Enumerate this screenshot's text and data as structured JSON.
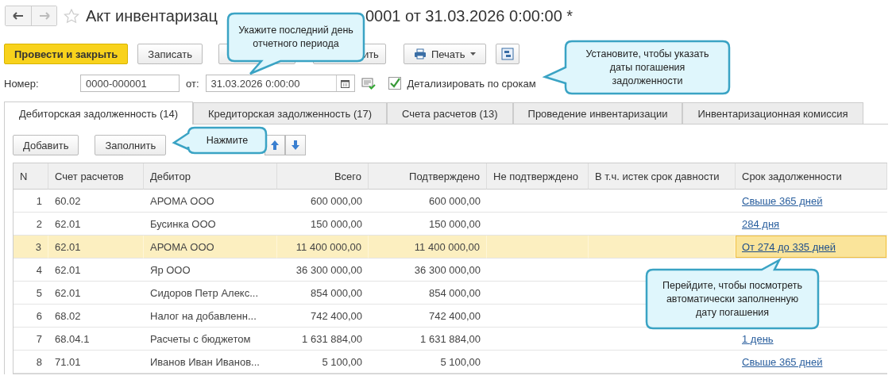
{
  "window": {
    "title_start": "Акт инвентаризац",
    "title_end": "0001 от 31.03.2026 0:00:00 *",
    "back_disabled": false,
    "forward_disabled": true
  },
  "toolbar": {
    "buttons": [
      {
        "label": "Провести и закрыть",
        "kind": "primary"
      },
      {
        "label": "Записать",
        "kind": "plain"
      },
      {
        "kind": "blank"
      },
      {
        "label": "ить",
        "kind": "cut"
      },
      {
        "label": "Печать",
        "kind": "menu"
      },
      {
        "kind": "icon"
      }
    ]
  },
  "header": {
    "number_label": "Номер:",
    "number": "0000-000001",
    "date_label": "от:",
    "date": "31.03.2026  0:00:00",
    "detail": {
      "label": "Детализировать по срокам",
      "checked": true
    }
  },
  "tabs": [
    {
      "label": "Дебиторская задолженность (14)",
      "selected": true
    },
    {
      "label": "Кредиторская задолженность (17)",
      "selected": false
    },
    {
      "label": "Счета расчетов (13)",
      "selected": false
    },
    {
      "label": "Проведение инвентаризации",
      "selected": false
    },
    {
      "label": "Инвентаризационная комиссия",
      "selected": false
    }
  ],
  "table_buttons": [
    "Добавить",
    "Заполнить"
  ],
  "table": {
    "columns": [
      "N",
      "Счет расчетов",
      "Дебитор",
      "Всего",
      "Подтверждено",
      "Не подтверждено",
      "В т.ч. истек срок давности",
      "Срок задолженности"
    ],
    "rows": [
      {
        "cells": [
          "1",
          "60.02",
          "АРОМА ООО",
          "600 000,00",
          "600 000,00",
          "",
          "",
          "Свыше 365 дней"
        ],
        "selected": false
      },
      {
        "cells": [
          "2",
          "62.01",
          "Бусинка ООО",
          "150 000,00",
          "150 000,00",
          "",
          "",
          "284 дня"
        ],
        "selected": false
      },
      {
        "cells": [
          "3",
          "62.01",
          "АРОМА ООО",
          "11 400 000,00",
          "11 400 000,00",
          "",
          "",
          "От 274 до 335 дней"
        ],
        "selected": true
      },
      {
        "cells": [
          "4",
          "62.01",
          "Яр ООО",
          "36 300 000,00",
          "36 300 000,00",
          "",
          "",
          ""
        ],
        "selected": false
      },
      {
        "cells": [
          "5",
          "62.01",
          "Сидоров Петр Алекс...",
          "854 000,00",
          "854 000,00",
          "",
          "",
          ""
        ],
        "selected": false
      },
      {
        "cells": [
          "6",
          "68.02",
          "Налог на добавленн...",
          "742 400,00",
          "742 400,00",
          "",
          "",
          ""
        ],
        "selected": false
      },
      {
        "cells": [
          "7",
          "68.04.1",
          "Расчеты с бюджетом",
          "1 631 884,00",
          "1 631 884,00",
          "",
          "",
          "1 день"
        ],
        "selected": false
      },
      {
        "cells": [
          "8",
          "71.01",
          "Иванов Иван Иванов...",
          "5 100,00",
          "5 100,00",
          "",
          "",
          "Свыше 365 дней"
        ],
        "selected": false
      }
    ]
  },
  "callouts": [
    {
      "text": "Укажите последний день отчетного периода"
    },
    {
      "text": "Установите, чтобы указать даты погашения задолженности"
    },
    {
      "text": "Нажмите"
    },
    {
      "text": "Перейдите, чтобы посмотреть автоматически заполненную дату погашения"
    }
  ]
}
